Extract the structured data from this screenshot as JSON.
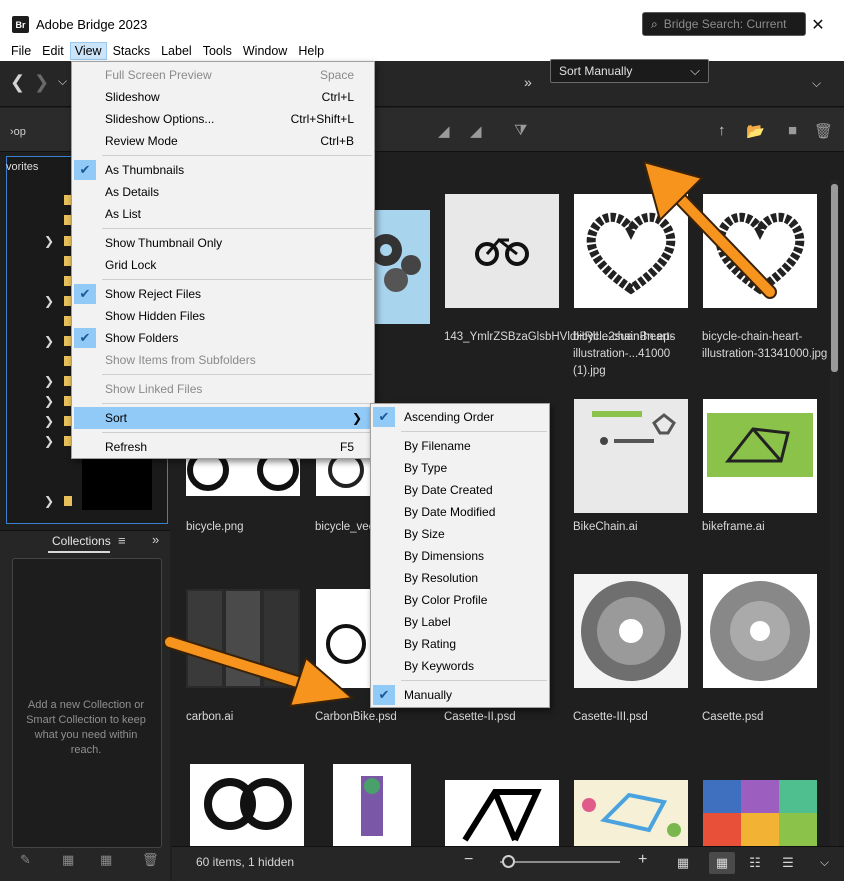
{
  "window": {
    "app_logo": "Br",
    "title": "Adobe Bridge 2023",
    "minimize": "—",
    "maximize": "☐",
    "close": "✕"
  },
  "menubar": [
    "File",
    "Edit",
    "View",
    "Stacks",
    "Label",
    "Tools",
    "Window",
    "Help"
  ],
  "active_menu": "View",
  "search": {
    "placeholder": "Bridge Search: Current"
  },
  "breadcrumb_fragment": "›op",
  "sort_select": {
    "value": "Sort Manually"
  },
  "left": {
    "favorites_label": "vorites",
    "collections_tab": "Collections",
    "collections_hint": "Add a new Collection or Smart Collection to keep what you need within reach."
  },
  "view_menu": {
    "items": [
      {
        "label": "Full Screen Preview",
        "shortcut": "Space",
        "disabled": true
      },
      {
        "label": "Slideshow",
        "shortcut": "Ctrl+L"
      },
      {
        "label": "Slideshow Options...",
        "shortcut": "Ctrl+Shift+L"
      },
      {
        "label": "Review Mode",
        "shortcut": "Ctrl+B"
      },
      {
        "label": "As Thumbnails",
        "checked": true
      },
      {
        "label": "As Details"
      },
      {
        "label": "As List"
      },
      {
        "label": "Show Thumbnail Only"
      },
      {
        "label": "Grid Lock"
      },
      {
        "label": "Show Reject Files",
        "checked": true
      },
      {
        "label": "Show Hidden Files"
      },
      {
        "label": "Show Folders",
        "checked": true
      },
      {
        "label": "Show Items from Subfolders",
        "disabled": true
      },
      {
        "label": "Show Linked Files",
        "disabled": true
      },
      {
        "label": "Sort",
        "submenu": true,
        "highlighted": true
      },
      {
        "label": "Refresh",
        "shortcut": "F5"
      }
    ]
  },
  "sort_menu": {
    "items": [
      {
        "label": "Ascending Order",
        "checked": true
      },
      {
        "label": "By Filename"
      },
      {
        "label": "By Type"
      },
      {
        "label": "By Date Created"
      },
      {
        "label": "By Date Modified"
      },
      {
        "label": "By Size"
      },
      {
        "label": "By Dimensions"
      },
      {
        "label": "By Resolution"
      },
      {
        "label": "By Color Profile"
      },
      {
        "label": "By Label"
      },
      {
        "label": "By Rating"
      },
      {
        "label": "By Keywords"
      },
      {
        "label": "Manually",
        "checked": true
      }
    ]
  },
  "files": {
    "row1": [
      {
        "name": "143_YmlrZSBzaGlsbHVldHRlI...2suanBn.eps"
      },
      {
        "name": "bicycle-chain-heart-illustration-...41000 (1).jpg"
      },
      {
        "name": "bicycle-chain-heart-illustration-31341000.jpg"
      }
    ],
    "row2": [
      {
        "name": "bicycle.png"
      },
      {
        "name": "bicycle_vec"
      },
      {
        "name": "BikeChain.ai"
      },
      {
        "name": "bikeframe.ai"
      }
    ],
    "row3": [
      {
        "name": "carbon.ai"
      },
      {
        "name": "CarbonBike.psd"
      },
      {
        "name": "Casette-II.psd"
      },
      {
        "name": "Casette-III.psd"
      },
      {
        "name": "Casette.psd"
      }
    ]
  },
  "status": {
    "count_text": "60 items, 1 hidden"
  },
  "colors": {
    "accent_arrow": "#f7941d",
    "highlight": "#91c9f7",
    "folder": "#e7c05b"
  }
}
